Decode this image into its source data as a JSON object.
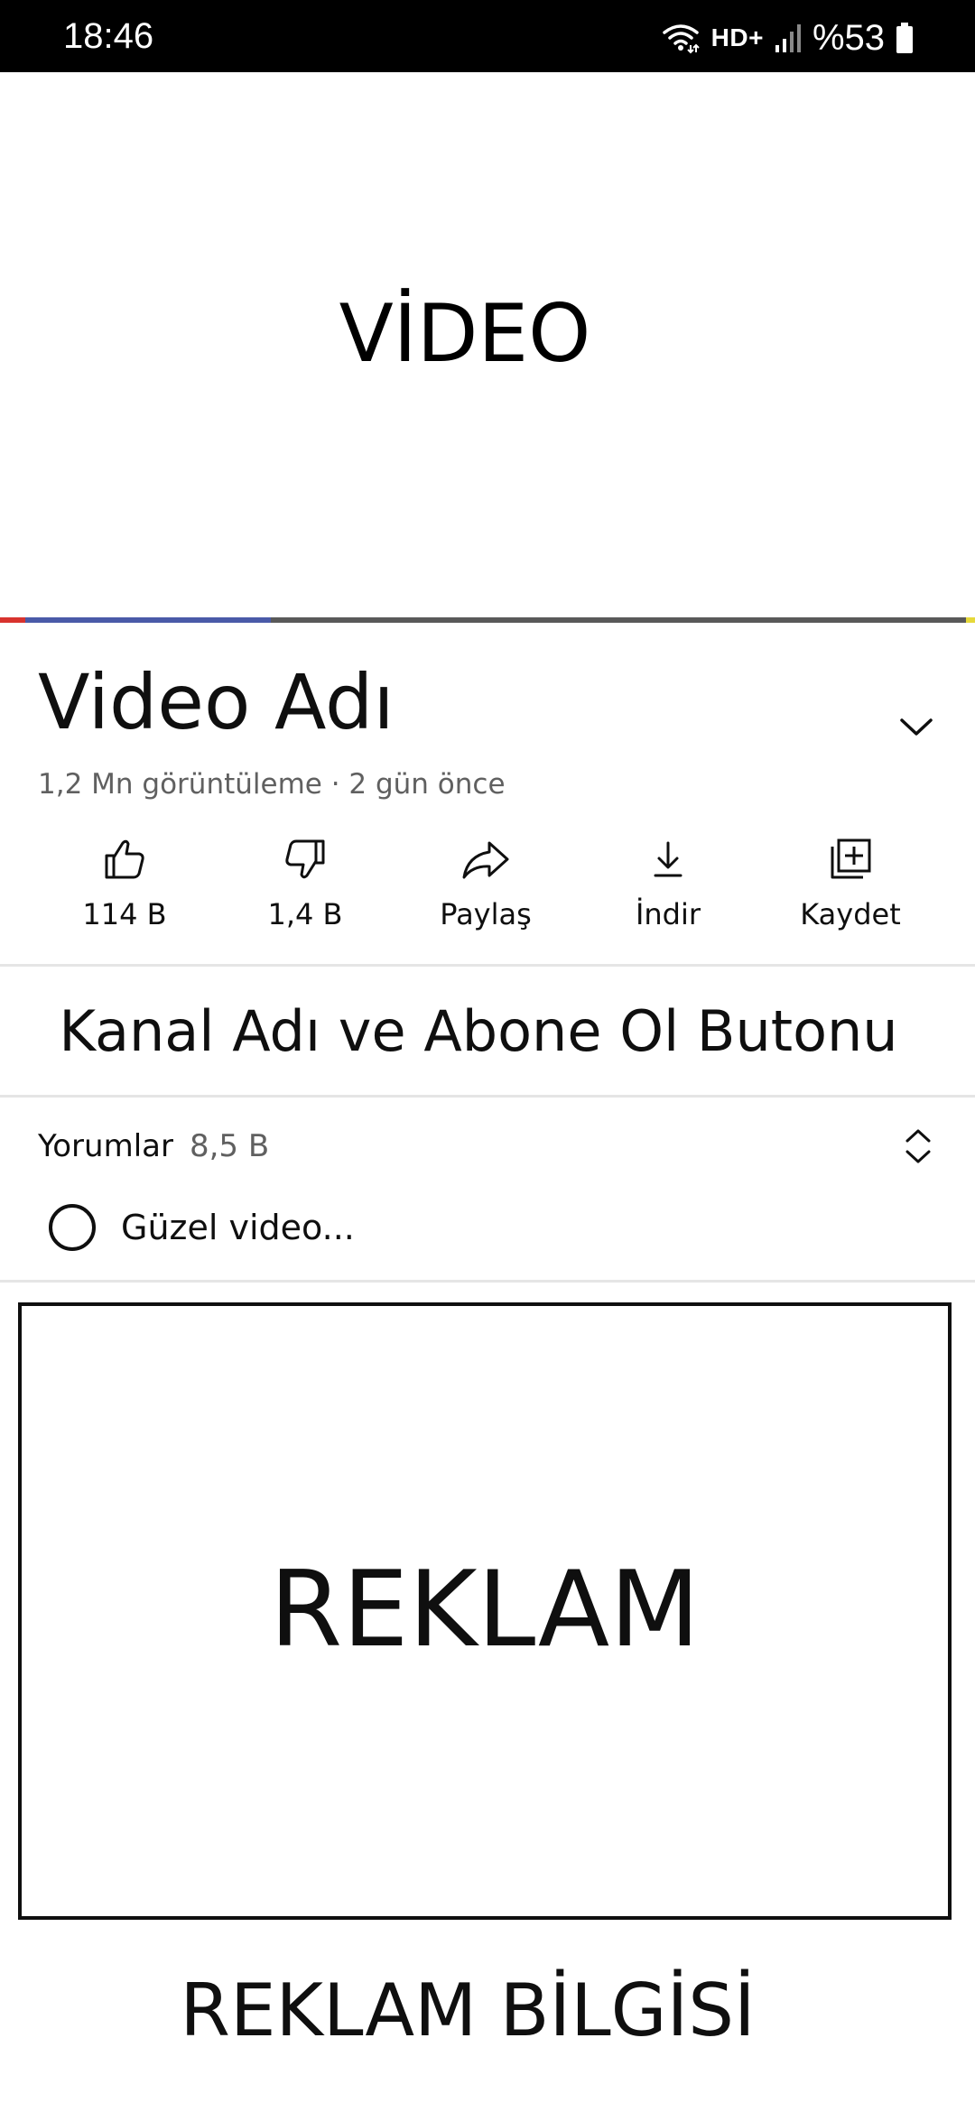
{
  "status_bar": {
    "time": "18:46",
    "network": "HD+",
    "battery": "%53",
    "icons": [
      "wifi-icon",
      "signal-icon",
      "battery-icon"
    ]
  },
  "video": {
    "placeholder": "VİDEO",
    "colors": {
      "played": "#d8332e",
      "buffered": "#4a5aa8",
      "track": "#595959",
      "marker": "#e6d93b"
    }
  },
  "details": {
    "title": "Video Adı",
    "meta": "1,2 Mn görüntüleme · 2 gün önce"
  },
  "actions": [
    {
      "icon": "thumbs-up-icon",
      "label": "114 B"
    },
    {
      "icon": "thumbs-down-icon",
      "label": "1,4 B"
    },
    {
      "icon": "share-icon",
      "label": "Paylaş"
    },
    {
      "icon": "download-icon",
      "label": "İndir"
    },
    {
      "icon": "save-playlist-icon",
      "label": "Kaydet"
    }
  ],
  "channel": {
    "placeholder": "Kanal Adı ve Abone Ol Butonu"
  },
  "comments": {
    "heading": "Yorumlar",
    "count": "8,5 B",
    "preview": "Güzel video..."
  },
  "ad": {
    "placeholder": "REKLAM",
    "info": "REKLAM BİLGİSİ"
  }
}
